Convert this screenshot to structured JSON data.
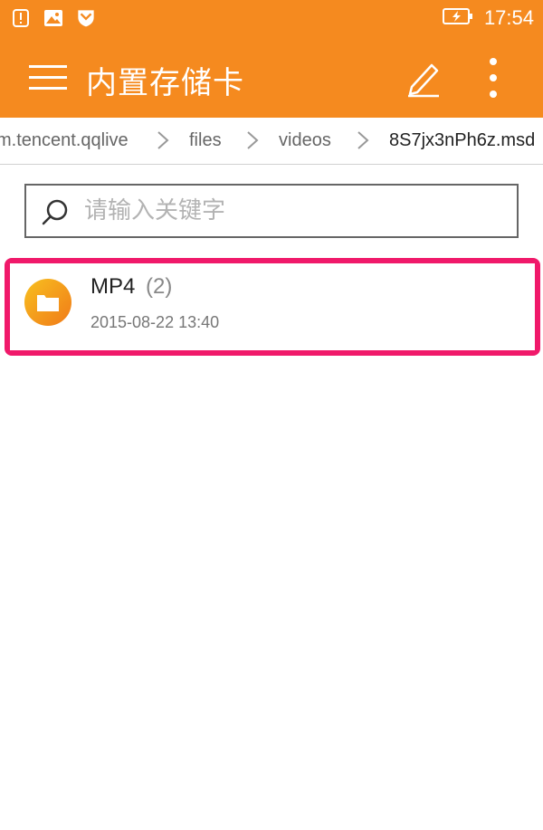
{
  "status_bar": {
    "time": "17:54",
    "icons": [
      "alert-notification-icon",
      "image-notification-icon",
      "shield-notification-icon",
      "battery-charging-icon"
    ]
  },
  "app_bar": {
    "title": "内置存储卡",
    "icons": [
      "menu-icon",
      "edit-icon",
      "more-vert-icon"
    ]
  },
  "breadcrumb": {
    "items": [
      "m.tencent.qqlive",
      "files",
      "videos",
      "8S7jx3nPh6z.msd"
    ]
  },
  "search": {
    "placeholder": "请输入关键字",
    "value": ""
  },
  "files": [
    {
      "name": "MP4",
      "count": "(2)",
      "date": "2015-08-22 13:40",
      "icon": "folder-icon"
    }
  ],
  "colors": {
    "accent": "#f58a1f",
    "highlight": "#f0196a",
    "folder_start": "#f8c020",
    "folder_end": "#f07a18"
  }
}
